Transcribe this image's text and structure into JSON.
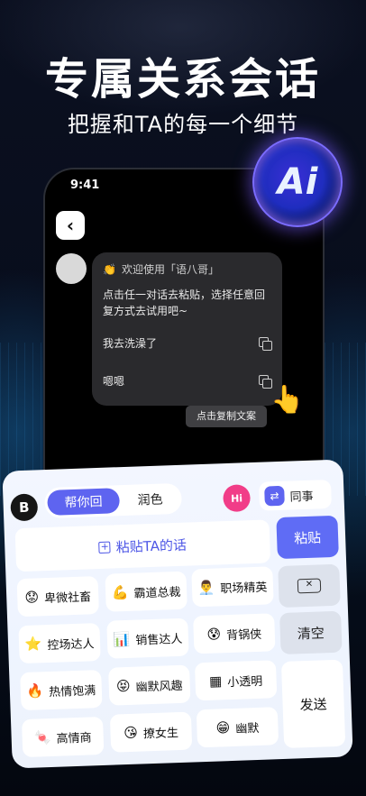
{
  "headline": "专属关系会话",
  "subline": "把握和TA的每一个细节",
  "ai_badge": "Ai",
  "phone": {
    "time": "9:41",
    "back_icon": "chevron-left",
    "greeting": "欢迎使用「语八哥」",
    "intro": "点击任一对话去粘贴，选择任意回复方式去试用吧~",
    "reply1": "我去洗澡了",
    "reply2": "嗯嗯",
    "tooltip": "点击复制文案"
  },
  "keyboard": {
    "logo": "B",
    "tab_active": "帮你回",
    "tab_inactive": "润色",
    "hi_label": "Hi",
    "colleague_label": "同事",
    "paste_placeholder": "粘贴TA的话",
    "paste_button": "粘贴",
    "clear_button": "清空",
    "send_button": "发送",
    "chips": [
      {
        "emoji": "😟",
        "label": "卑微社畜"
      },
      {
        "emoji": "💪",
        "label": "霸道总裁"
      },
      {
        "emoji": "👨‍💼",
        "label": "职场精英"
      },
      {
        "emoji": "⭐",
        "label": "控场达人"
      },
      {
        "emoji": "📊",
        "label": "销售达人"
      },
      {
        "emoji": "😰",
        "label": "背锅侠"
      },
      {
        "emoji": "🔥",
        "label": "热情饱满"
      },
      {
        "emoji": "😝",
        "label": "幽默风趣"
      },
      {
        "emoji": "▦",
        "label": "小透明"
      },
      {
        "emoji": "🍬",
        "label": "高情商"
      },
      {
        "emoji": "😘",
        "label": "撩女生"
      },
      {
        "emoji": "😁",
        "label": "幽默"
      }
    ]
  }
}
